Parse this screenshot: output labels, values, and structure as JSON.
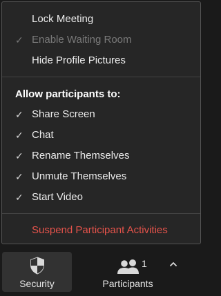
{
  "menu": {
    "top_items": [
      {
        "label": "Lock Meeting",
        "checked": false,
        "disabled": false
      },
      {
        "label": "Enable Waiting Room",
        "checked": true,
        "disabled": true
      },
      {
        "label": "Hide Profile Pictures",
        "checked": false,
        "disabled": false
      }
    ],
    "section_header": "Allow participants to:",
    "permissions": [
      {
        "label": "Share Screen",
        "checked": true
      },
      {
        "label": "Chat",
        "checked": true
      },
      {
        "label": "Rename Themselves",
        "checked": true
      },
      {
        "label": "Unmute Themselves",
        "checked": true
      },
      {
        "label": "Start Video",
        "checked": true
      }
    ],
    "check_glyph": "✓",
    "suspend_label": "Suspend Participant Activities",
    "danger_color": "#e5534b"
  },
  "toolbar": {
    "security_label": "Security",
    "security_icon": "shield-icon",
    "participants_label": "Participants",
    "participants_icon": "people-icon",
    "participants_count": "1",
    "caret_icon": "chevron-up-icon"
  }
}
